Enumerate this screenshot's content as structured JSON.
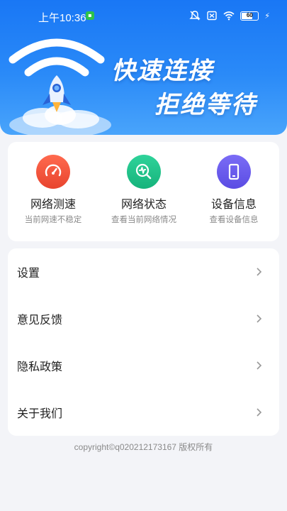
{
  "status_bar": {
    "time": "上午10:36",
    "battery_level": "60",
    "icons": [
      "notification-badge-icon",
      "mute-icon",
      "sim-off-icon",
      "wifi-icon",
      "battery-icon",
      "charging-icon"
    ]
  },
  "hero": {
    "slogan_line1": "快速连接",
    "slogan_line2": "拒绝等待",
    "colors": {
      "top": "#1977f5",
      "bottom": "#49a4fb"
    }
  },
  "tools": [
    {
      "title": "网络测速",
      "subtitle": "当前网速不稳定",
      "icon": "speedometer-icon",
      "color": "#f0553c"
    },
    {
      "title": "网络状态",
      "subtitle": "查看当前网络情况",
      "icon": "network-status-icon",
      "color": "#22c38a"
    },
    {
      "title": "设备信息",
      "subtitle": "查看设备信息",
      "icon": "phone-device-icon",
      "color": "#6a5df0"
    }
  ],
  "menu": [
    {
      "label": "设置"
    },
    {
      "label": "意见反馈"
    },
    {
      "label": "隐私政策"
    },
    {
      "label": "关于我们"
    }
  ],
  "footer": {
    "copyright": "copyright©q020212173167 版权所有"
  }
}
